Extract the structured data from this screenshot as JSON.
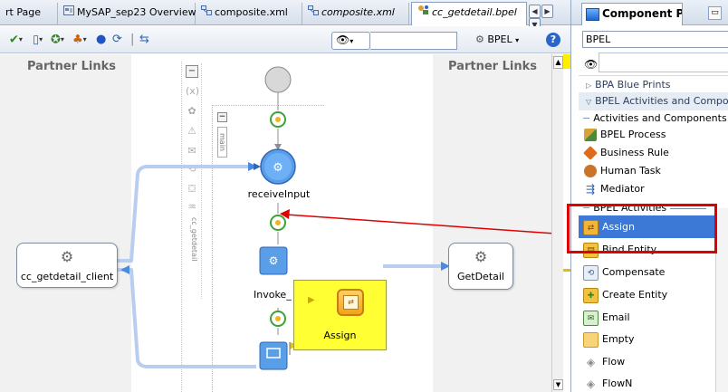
{
  "tabs": [
    {
      "label": "rt Page",
      "icon": "none"
    },
    {
      "label": "MySAP_sep23 Overview",
      "icon": "overview-icon"
    },
    {
      "label": "composite.xml",
      "icon": "composite-icon"
    },
    {
      "label": "composite.xml",
      "icon": "composite-icon"
    },
    {
      "label": "cc_getdetail.bpel",
      "icon": "bpel-icon"
    }
  ],
  "toolbar": {
    "search_value": "",
    "bpel_label": "BPEL",
    "help_label": "?"
  },
  "canvas": {
    "partner_links_left": "Partner Links",
    "partner_links_right": "Partner Links",
    "vertical_scope_label": "cc_getdetail",
    "main_label": "main",
    "receive_label": "receiveInput",
    "invoke_label": "Invoke_",
    "client_label": "cc_getdetail_client",
    "service_label": "GetDetail",
    "drag_label": "Assign"
  },
  "palette": {
    "title": "Component P...",
    "dropdown_value": "BPEL",
    "search_value": "",
    "categories": [
      {
        "label": "BPA Blue Prints"
      },
      {
        "label": "BPEL Activities and Components"
      }
    ],
    "section1": {
      "title": "Activities and Components",
      "items": [
        {
          "label": "BPEL Process",
          "icon": "bpel-process-icon"
        },
        {
          "label": "Business Rule",
          "icon": "business-rule-icon"
        },
        {
          "label": "Human Task",
          "icon": "human-task-icon"
        },
        {
          "label": "Mediator",
          "icon": "mediator-icon"
        }
      ]
    },
    "section2": {
      "title": "BPEL Activities",
      "items": [
        {
          "label": "Assign",
          "icon": "assign-icon",
          "selected": true
        },
        {
          "label": "Bind Entity",
          "icon": "bind-entity-icon"
        },
        {
          "label": "Compensate",
          "icon": "compensate-icon"
        },
        {
          "label": "Create Entity",
          "icon": "create-entity-icon"
        },
        {
          "label": "Email",
          "icon": "email-icon"
        },
        {
          "label": "Empty",
          "icon": "empty-icon"
        },
        {
          "label": "Flow",
          "icon": "flow-icon"
        },
        {
          "label": "FlowN",
          "icon": "flown-icon"
        }
      ]
    }
  },
  "colors": {
    "highlight": "#e00000",
    "drag_bg": "#ffff33",
    "selection": "#3c78d6",
    "connector": "#b9cdf0"
  }
}
